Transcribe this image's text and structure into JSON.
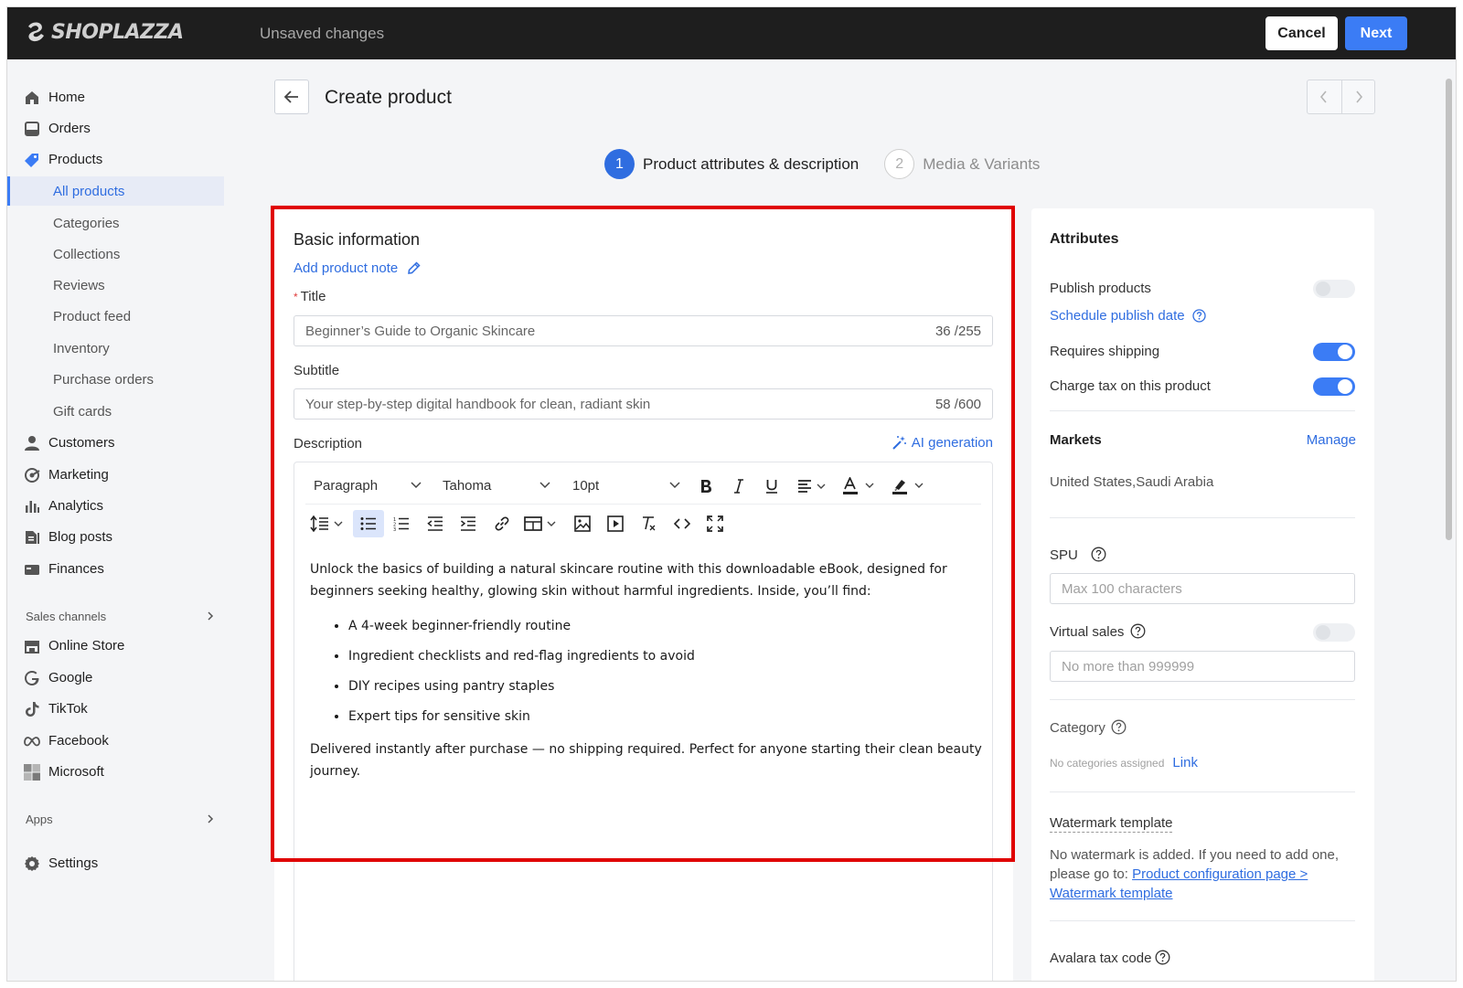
{
  "topbar": {
    "logo_text": "SHOPLAZZA",
    "status": "Unsaved changes",
    "cancel_label": "Cancel",
    "next_label": "Next",
    "accent": "#3b7cf5"
  },
  "sidebar": {
    "items": [
      {
        "label": "Home",
        "icon": "home-icon"
      },
      {
        "label": "Orders",
        "icon": "orders-icon"
      },
      {
        "label": "Products",
        "icon": "tag-icon"
      }
    ],
    "product_subitems": [
      "All products",
      "Categories",
      "Collections",
      "Reviews",
      "Product feed",
      "Inventory",
      "Purchase orders",
      "Gift cards"
    ],
    "more_items": [
      {
        "label": "Customers",
        "icon": "user-icon"
      },
      {
        "label": "Marketing",
        "icon": "marketing-icon"
      },
      {
        "label": "Analytics",
        "icon": "analytics-icon"
      },
      {
        "label": "Blog posts",
        "icon": "blog-icon"
      },
      {
        "label": "Finances",
        "icon": "finances-icon"
      }
    ],
    "sales_channels_label": "Sales channels",
    "channels": [
      {
        "label": "Online Store",
        "icon": "store-icon"
      },
      {
        "label": "Google",
        "icon": "google-icon"
      },
      {
        "label": "TikTok",
        "icon": "tiktok-icon"
      },
      {
        "label": "Facebook",
        "icon": "meta-icon"
      },
      {
        "label": "Microsoft",
        "icon": "microsoft-icon"
      }
    ],
    "apps_label": "Apps",
    "settings_label": "Settings"
  },
  "page": {
    "title": "Create product",
    "steps": [
      {
        "number": "1",
        "label": "Product attributes & description"
      },
      {
        "number": "2",
        "label": "Media & Variants"
      }
    ]
  },
  "basic": {
    "heading": "Basic information",
    "add_note": "Add product note",
    "title_label": "Title",
    "title_required": "*",
    "title_value": "Beginner’s Guide to Organic Skincare",
    "title_count": "36 /255",
    "subtitle_label": "Subtitle",
    "subtitle_value": "Your step-by-step digital handbook for clean, radiant skin",
    "subtitle_count": "58 /600",
    "description_label": "Description",
    "ai_label": "AI generation"
  },
  "editor": {
    "block_format": "Paragraph",
    "font_family": "Tahoma",
    "font_size": "10pt",
    "intro": "Unlock the basics of building a natural skincare routine with this downloadable eBook, designed for beginners seeking healthy, glowing skin without harmful ingredients. Inside, you’ll find:",
    "bullets": [
      "A 4-week beginner-friendly routine",
      "Ingredient checklists and red-flag ingredients to avoid",
      "DIY recipes using pantry staples",
      "Expert tips for sensitive skin"
    ],
    "closing": "Delivered instantly after purchase — no shipping required. Perfect for anyone starting their clean beauty journey."
  },
  "attributes": {
    "heading": "Attributes",
    "publish_label": "Publish products",
    "publish_on": false,
    "schedule_label": "Schedule publish date",
    "shipping_label": "Requires shipping",
    "shipping_on": true,
    "tax_label": "Charge tax on this product",
    "tax_on": true,
    "markets_label": "Markets",
    "manage_label": "Manage",
    "markets_value": "United States,Saudi Arabia",
    "spu_label": "SPU",
    "spu_placeholder": "Max 100 characters",
    "virtual_label": "Virtual sales",
    "virtual_on": false,
    "virtual_placeholder": "No more than 999999",
    "category_label": "Category",
    "category_none": "No categories assigned",
    "category_link": "Link",
    "watermark_label": "Watermark template",
    "watermark_text": "No watermark is added. If you need to add one, please go to:",
    "watermark_link": "Product configuration page > Watermark template",
    "avalara_label": "Avalara tax code"
  }
}
